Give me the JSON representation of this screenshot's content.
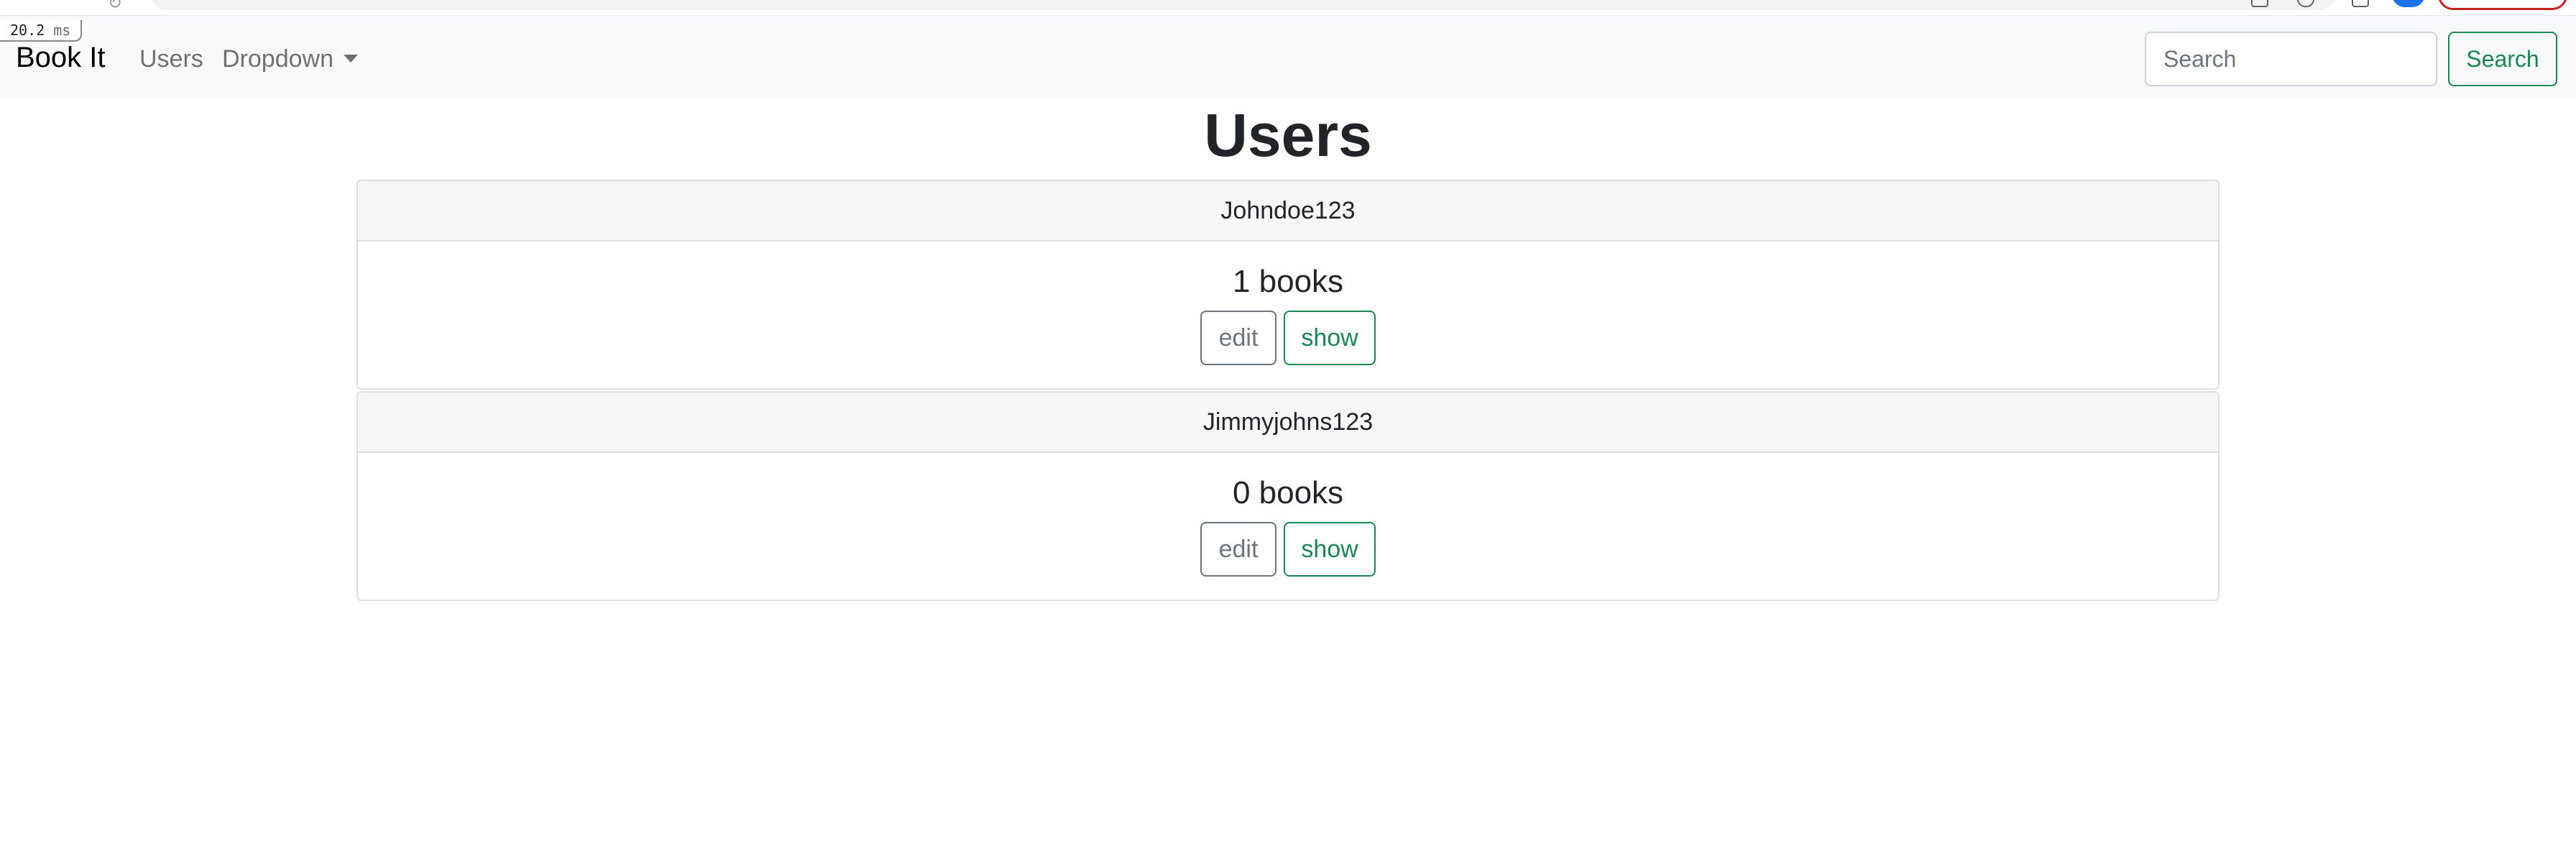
{
  "timing": {
    "value": "20.2",
    "unit": "ms"
  },
  "navbar": {
    "brand": "Book It",
    "links": [
      {
        "label": "Users"
      },
      {
        "label": "Dropdown"
      }
    ],
    "search": {
      "placeholder": "Search",
      "button_label": "Search"
    }
  },
  "page": {
    "title": "Users"
  },
  "users": [
    {
      "username": "Johndoe123",
      "books": "1 books",
      "edit_label": "edit",
      "show_label": "show"
    },
    {
      "username": "Jimmyjohns123",
      "books": "0 books",
      "edit_label": "edit",
      "show_label": "show"
    }
  ],
  "colors": {
    "navbar_bg": "#f8f9fa",
    "success": "#198754",
    "secondary": "#6c757d",
    "card_header_bg": "#f7f7f7"
  }
}
